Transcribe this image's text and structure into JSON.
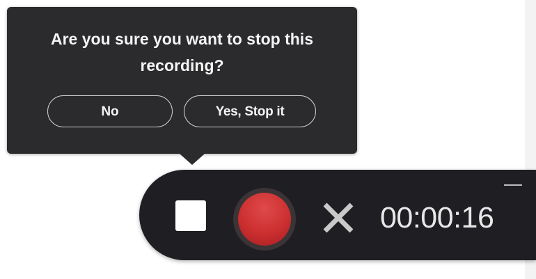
{
  "confirm_popup": {
    "question": "Are you sure you want to stop this recording?",
    "no_label": "No",
    "yes_label": "Yes, Stop it"
  },
  "recorder": {
    "elapsed": "00:00:16",
    "icons": {
      "stop": "stop-square-icon",
      "record": "record-dot-icon",
      "cancel": "close-x-icon",
      "minimize": "minimize-icon"
    }
  },
  "colors": {
    "popup_bg": "#2b2b2d",
    "bar_bg": "#1f1e23",
    "record_red": "#cc2f30",
    "text_light": "#f4f4f4"
  }
}
